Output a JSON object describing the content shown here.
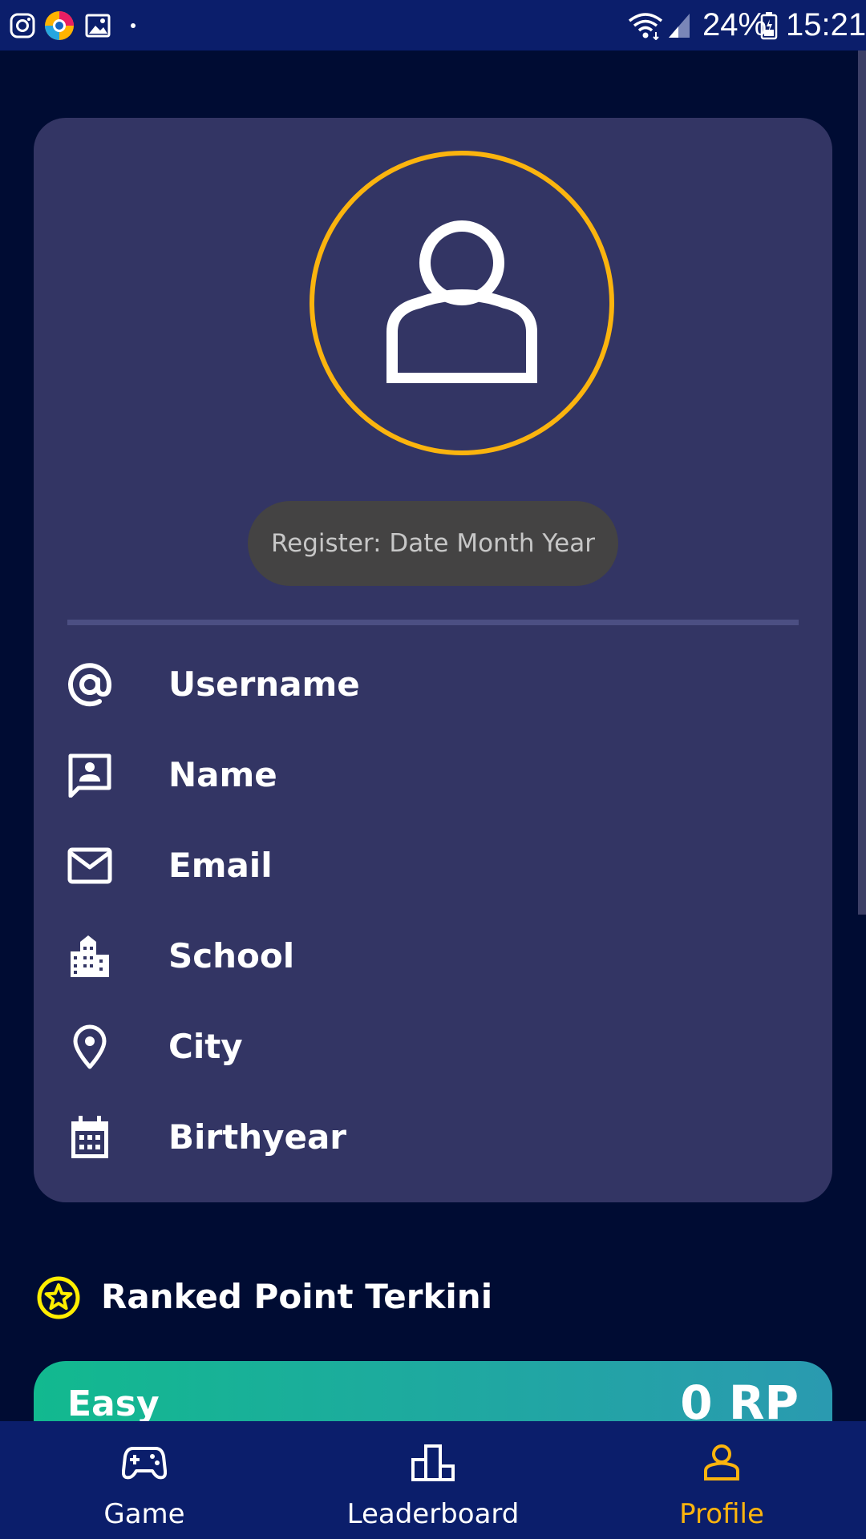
{
  "status_bar": {
    "battery_percent": "24%",
    "time": "15:21",
    "icons": [
      "instagram-icon",
      "browser-icon",
      "gallery-icon",
      "notification-dot-icon",
      "wifi-icon",
      "signal-icon",
      "battery-icon"
    ]
  },
  "profile": {
    "avatar_icon": "person-outline-icon",
    "register_text": "Register: Date Month Year",
    "fields": [
      {
        "icon": "at-sign-icon",
        "label": "Username"
      },
      {
        "icon": "name-card-icon",
        "label": "Name"
      },
      {
        "icon": "mail-icon",
        "label": "Email"
      },
      {
        "icon": "building-icon",
        "label": "School"
      },
      {
        "icon": "location-pin-icon",
        "label": "City"
      },
      {
        "icon": "calendar-icon",
        "label": "Birthyear"
      }
    ]
  },
  "ranked": {
    "title": "Ranked Point Terkini",
    "items": [
      {
        "level": "Easy",
        "value": "0 RP"
      }
    ]
  },
  "nav": {
    "items": [
      {
        "icon": "gamepad-icon",
        "label": "Game",
        "active": false
      },
      {
        "icon": "leaderboard-icon",
        "label": "Leaderboard",
        "active": false
      },
      {
        "icon": "profile-icon",
        "label": "Profile",
        "active": true
      }
    ]
  },
  "colors": {
    "background": "#000c33",
    "status_bar": "#0b1e6b",
    "card": "#333564",
    "accent": "#fbb40e",
    "star": "#ffee00",
    "rp_gradient_start": "#12b98f",
    "rp_gradient_end": "#2a9ab0"
  }
}
